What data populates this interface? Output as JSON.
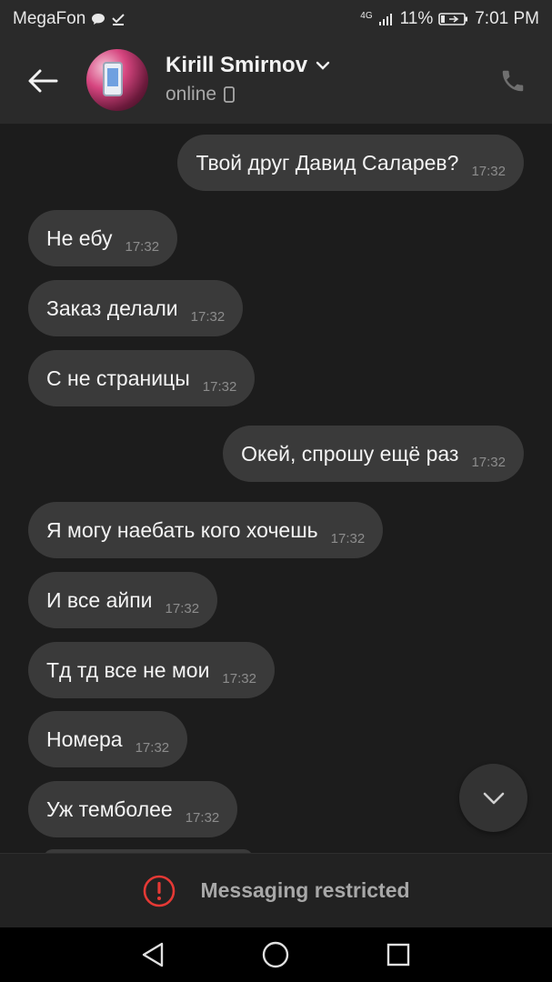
{
  "status_bar": {
    "carrier": "MegaFon",
    "network": "4G",
    "battery": "11%",
    "time": "7:01 PM"
  },
  "header": {
    "contact_name": "Kirill Smirnov",
    "contact_status": "online"
  },
  "messages": [
    {
      "direction": "out",
      "text": "Твой друг Давид Саларев?",
      "time": "17:32"
    },
    {
      "direction": "in",
      "text": "Не ебу",
      "time": "17:32"
    },
    {
      "direction": "in",
      "text": "Заказ делали",
      "time": "17:32"
    },
    {
      "direction": "in",
      "text": "С не страницы",
      "time": "17:32"
    },
    {
      "direction": "out",
      "text": "Окей, спрошу ещё раз",
      "time": "17:32"
    },
    {
      "direction": "in",
      "text": "Я могу наебать кого хочешь",
      "time": "17:32"
    },
    {
      "direction": "in",
      "text": "И все айпи",
      "time": "17:32"
    },
    {
      "direction": "in",
      "text": "Тд тд все не мои",
      "time": "17:32"
    },
    {
      "direction": "in",
      "text": "Номера",
      "time": "17:32"
    },
    {
      "direction": "in",
      "text": "Уж темболее",
      "time": "17:32"
    }
  ],
  "footer": {
    "restricted_label": "Messaging restricted"
  },
  "colors": {
    "bubble": "#3a3a3a",
    "background": "#1c1c1c",
    "header": "#2a2a2a",
    "alert_red": "#e53935"
  },
  "icons": {
    "back": "arrow-left-icon",
    "call": "phone-icon",
    "expand": "chevron-down-icon",
    "device": "mobile-icon",
    "scroll_down": "chevron-down-icon",
    "restricted": "alert-circle-icon"
  }
}
